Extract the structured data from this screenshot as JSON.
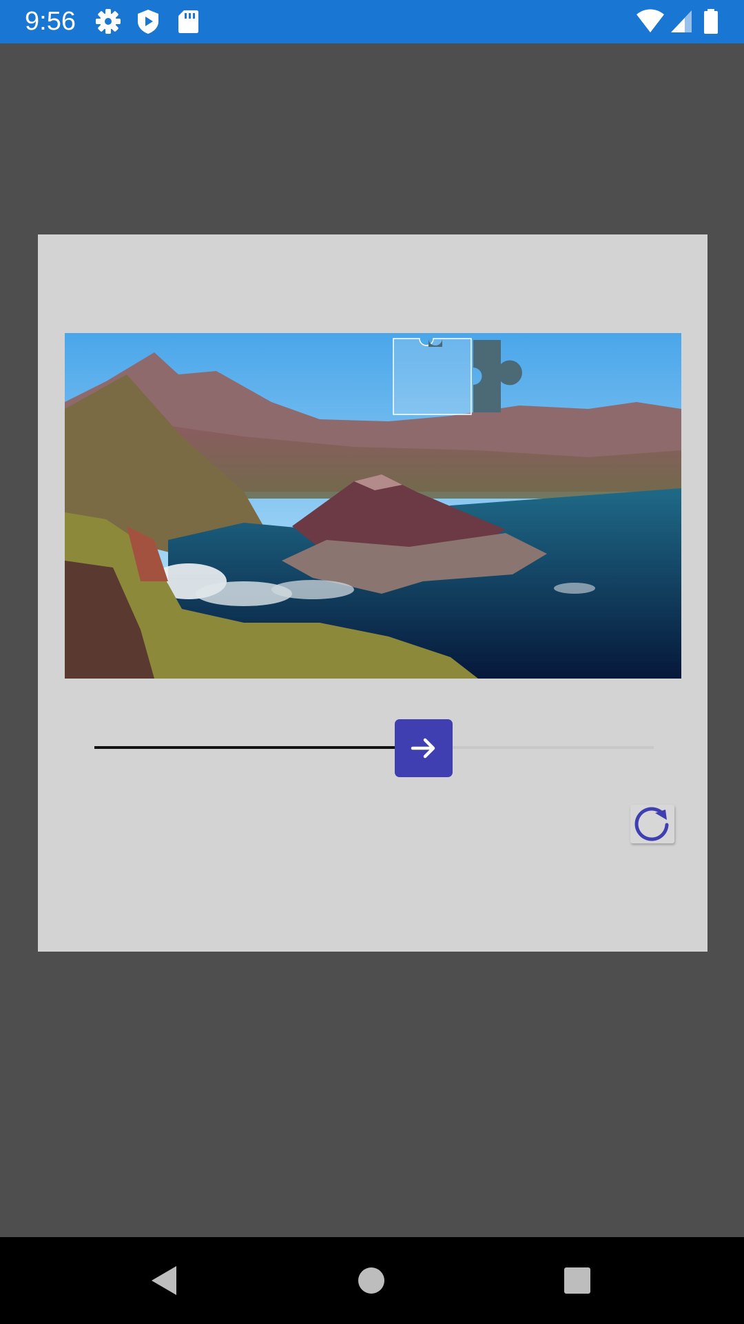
{
  "status_bar": {
    "time": "9:56",
    "left_icons": [
      "gear-icon",
      "shield-play-icon",
      "sd-card-icon"
    ],
    "right_icons": [
      "wifi-icon",
      "cell-signal-icon",
      "battery-icon"
    ],
    "color": "#1976d2"
  },
  "captcha": {
    "slider_progress": 0.55,
    "thumb_icon": "arrow-right-icon",
    "thumb_color": "#3f3fb2",
    "refresh_icon": "refresh-icon"
  },
  "nav_bar": {
    "buttons": [
      "back-icon",
      "home-icon",
      "recents-icon"
    ]
  }
}
